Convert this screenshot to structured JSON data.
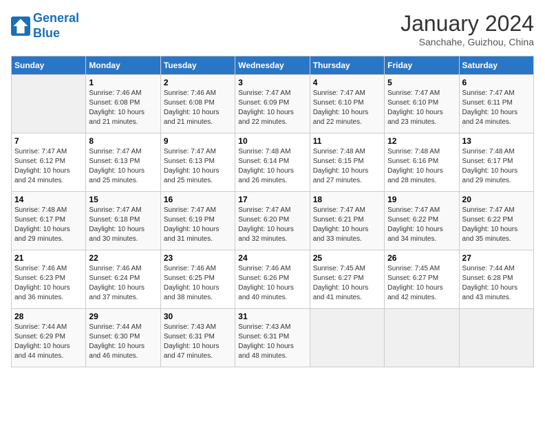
{
  "header": {
    "logo_line1": "General",
    "logo_line2": "Blue",
    "month": "January 2024",
    "location": "Sanchahe, Guizhou, China"
  },
  "days_of_week": [
    "Sunday",
    "Monday",
    "Tuesday",
    "Wednesday",
    "Thursday",
    "Friday",
    "Saturday"
  ],
  "weeks": [
    [
      {
        "num": "",
        "sunrise": "",
        "sunset": "",
        "daylight": ""
      },
      {
        "num": "1",
        "sunrise": "Sunrise: 7:46 AM",
        "sunset": "Sunset: 6:08 PM",
        "daylight": "Daylight: 10 hours and 21 minutes."
      },
      {
        "num": "2",
        "sunrise": "Sunrise: 7:46 AM",
        "sunset": "Sunset: 6:08 PM",
        "daylight": "Daylight: 10 hours and 21 minutes."
      },
      {
        "num": "3",
        "sunrise": "Sunrise: 7:47 AM",
        "sunset": "Sunset: 6:09 PM",
        "daylight": "Daylight: 10 hours and 22 minutes."
      },
      {
        "num": "4",
        "sunrise": "Sunrise: 7:47 AM",
        "sunset": "Sunset: 6:10 PM",
        "daylight": "Daylight: 10 hours and 22 minutes."
      },
      {
        "num": "5",
        "sunrise": "Sunrise: 7:47 AM",
        "sunset": "Sunset: 6:10 PM",
        "daylight": "Daylight: 10 hours and 23 minutes."
      },
      {
        "num": "6",
        "sunrise": "Sunrise: 7:47 AM",
        "sunset": "Sunset: 6:11 PM",
        "daylight": "Daylight: 10 hours and 24 minutes."
      }
    ],
    [
      {
        "num": "7",
        "sunrise": "Sunrise: 7:47 AM",
        "sunset": "Sunset: 6:12 PM",
        "daylight": "Daylight: 10 hours and 24 minutes."
      },
      {
        "num": "8",
        "sunrise": "Sunrise: 7:47 AM",
        "sunset": "Sunset: 6:13 PM",
        "daylight": "Daylight: 10 hours and 25 minutes."
      },
      {
        "num": "9",
        "sunrise": "Sunrise: 7:47 AM",
        "sunset": "Sunset: 6:13 PM",
        "daylight": "Daylight: 10 hours and 25 minutes."
      },
      {
        "num": "10",
        "sunrise": "Sunrise: 7:48 AM",
        "sunset": "Sunset: 6:14 PM",
        "daylight": "Daylight: 10 hours and 26 minutes."
      },
      {
        "num": "11",
        "sunrise": "Sunrise: 7:48 AM",
        "sunset": "Sunset: 6:15 PM",
        "daylight": "Daylight: 10 hours and 27 minutes."
      },
      {
        "num": "12",
        "sunrise": "Sunrise: 7:48 AM",
        "sunset": "Sunset: 6:16 PM",
        "daylight": "Daylight: 10 hours and 28 minutes."
      },
      {
        "num": "13",
        "sunrise": "Sunrise: 7:48 AM",
        "sunset": "Sunset: 6:17 PM",
        "daylight": "Daylight: 10 hours and 29 minutes."
      }
    ],
    [
      {
        "num": "14",
        "sunrise": "Sunrise: 7:48 AM",
        "sunset": "Sunset: 6:17 PM",
        "daylight": "Daylight: 10 hours and 29 minutes."
      },
      {
        "num": "15",
        "sunrise": "Sunrise: 7:47 AM",
        "sunset": "Sunset: 6:18 PM",
        "daylight": "Daylight: 10 hours and 30 minutes."
      },
      {
        "num": "16",
        "sunrise": "Sunrise: 7:47 AM",
        "sunset": "Sunset: 6:19 PM",
        "daylight": "Daylight: 10 hours and 31 minutes."
      },
      {
        "num": "17",
        "sunrise": "Sunrise: 7:47 AM",
        "sunset": "Sunset: 6:20 PM",
        "daylight": "Daylight: 10 hours and 32 minutes."
      },
      {
        "num": "18",
        "sunrise": "Sunrise: 7:47 AM",
        "sunset": "Sunset: 6:21 PM",
        "daylight": "Daylight: 10 hours and 33 minutes."
      },
      {
        "num": "19",
        "sunrise": "Sunrise: 7:47 AM",
        "sunset": "Sunset: 6:22 PM",
        "daylight": "Daylight: 10 hours and 34 minutes."
      },
      {
        "num": "20",
        "sunrise": "Sunrise: 7:47 AM",
        "sunset": "Sunset: 6:22 PM",
        "daylight": "Daylight: 10 hours and 35 minutes."
      }
    ],
    [
      {
        "num": "21",
        "sunrise": "Sunrise: 7:46 AM",
        "sunset": "Sunset: 6:23 PM",
        "daylight": "Daylight: 10 hours and 36 minutes."
      },
      {
        "num": "22",
        "sunrise": "Sunrise: 7:46 AM",
        "sunset": "Sunset: 6:24 PM",
        "daylight": "Daylight: 10 hours and 37 minutes."
      },
      {
        "num": "23",
        "sunrise": "Sunrise: 7:46 AM",
        "sunset": "Sunset: 6:25 PM",
        "daylight": "Daylight: 10 hours and 38 minutes."
      },
      {
        "num": "24",
        "sunrise": "Sunrise: 7:46 AM",
        "sunset": "Sunset: 6:26 PM",
        "daylight": "Daylight: 10 hours and 40 minutes."
      },
      {
        "num": "25",
        "sunrise": "Sunrise: 7:45 AM",
        "sunset": "Sunset: 6:27 PM",
        "daylight": "Daylight: 10 hours and 41 minutes."
      },
      {
        "num": "26",
        "sunrise": "Sunrise: 7:45 AM",
        "sunset": "Sunset: 6:27 PM",
        "daylight": "Daylight: 10 hours and 42 minutes."
      },
      {
        "num": "27",
        "sunrise": "Sunrise: 7:44 AM",
        "sunset": "Sunset: 6:28 PM",
        "daylight": "Daylight: 10 hours and 43 minutes."
      }
    ],
    [
      {
        "num": "28",
        "sunrise": "Sunrise: 7:44 AM",
        "sunset": "Sunset: 6:29 PM",
        "daylight": "Daylight: 10 hours and 44 minutes."
      },
      {
        "num": "29",
        "sunrise": "Sunrise: 7:44 AM",
        "sunset": "Sunset: 6:30 PM",
        "daylight": "Daylight: 10 hours and 46 minutes."
      },
      {
        "num": "30",
        "sunrise": "Sunrise: 7:43 AM",
        "sunset": "Sunset: 6:31 PM",
        "daylight": "Daylight: 10 hours and 47 minutes."
      },
      {
        "num": "31",
        "sunrise": "Sunrise: 7:43 AM",
        "sunset": "Sunset: 6:31 PM",
        "daylight": "Daylight: 10 hours and 48 minutes."
      },
      {
        "num": "",
        "sunrise": "",
        "sunset": "",
        "daylight": ""
      },
      {
        "num": "",
        "sunrise": "",
        "sunset": "",
        "daylight": ""
      },
      {
        "num": "",
        "sunrise": "",
        "sunset": "",
        "daylight": ""
      }
    ]
  ]
}
